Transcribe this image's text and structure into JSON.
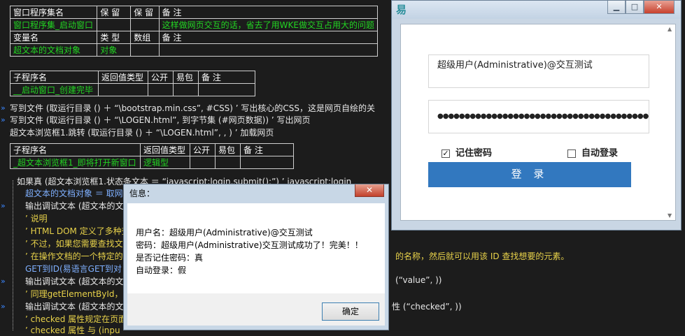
{
  "ide": {
    "window_table": {
      "headers": [
        "窗口程序集名",
        "保 留",
        "保 留",
        "备 注"
      ],
      "row": [
        "窗口程序集_启动窗口",
        "",
        "",
        "这样做网页交互的话，省去了用WKE做交互占用大的问题"
      ],
      "var_headers": [
        "变量名",
        "类 型",
        "数组",
        "备 注"
      ],
      "var_row": [
        "超文本的文档对象",
        "对象",
        "",
        ""
      ]
    },
    "sub1_table": {
      "headers": [
        "子程序名",
        "返回值类型",
        "公开",
        "易包",
        "备 注"
      ],
      "row": [
        "__启动窗口_创建完毕",
        "",
        "",
        "",
        ""
      ]
    },
    "code1": [
      "写到文件 (取运行目录 () ＋ “\\bootstrap.min.css”, #CSS) ’ 写出核心的CSS，这是网页自绘的关",
      "写到文件 (取运行目录 () ＋ “\\LOGEN.html”, 到字节集 (#网页数据)) ’ 写出网页",
      "超文本浏览框1.跳转 (取运行目录 () ＋ “\\LOGEN.html”, , ) ’ 加载网页"
    ],
    "sub2_table": {
      "headers": [
        "子程序名",
        "返回值类型",
        "公开",
        "易包",
        "备 注"
      ],
      "row": [
        "_超文本浏览框1_即将打开新窗口",
        "逻辑型",
        "",
        "",
        ""
      ]
    },
    "code2": [
      "如果真 (超文本浏览框1.状态条文本 ＝ “javascript:login.submit();”) ’ javascript:login",
      "超文本的文档对象 ＝ 取网",
      "输出调试文本 (超文本的文",
      "’ 说明",
      "’ HTML DOM 定义了多种查",
      "’ 不过，如果您需要查找文",
      "’ 在操作文档的一个特定的",
      "GET到ID(易语言GET到对",
      "输出调试文本 (超文本的文",
      "’ 同理getElementById，用",
      "输出调试文本 (超文本的文",
      "’ checked 属性规定在页面",
      "’ checked 属性 与 (inpu"
    ],
    "code2_tails": [
      "的名称，然后就可以用该 ID 查找想要的元素。",
      "(“value”, ))",
      "性 (“checked”, ))"
    ]
  },
  "login_window": {
    "app_icon": "易",
    "minimize": "▁",
    "maximize": "□",
    "close": "✕",
    "username_value": "超级用户(Administrative)@交互测试",
    "password_value": "●●●●●●●●●●●●●●●●●●●●●●●●●●●●●●●●●●●●●●●●●●●●●",
    "remember_label": "记住密码",
    "remember_checked": true,
    "auto_login_label": "自动登录",
    "auto_login_checked": false,
    "login_button": "登 录"
  },
  "message_box": {
    "title": "信息：",
    "close": "✕",
    "lines": [
      "用户名：超级用户(Administrative)@交互测试",
      "密码：超级用户(Administrative)交互测试成功了！完美！！",
      "是否记住密码：真",
      "自动登录：假"
    ],
    "ok_button": "确定"
  }
}
